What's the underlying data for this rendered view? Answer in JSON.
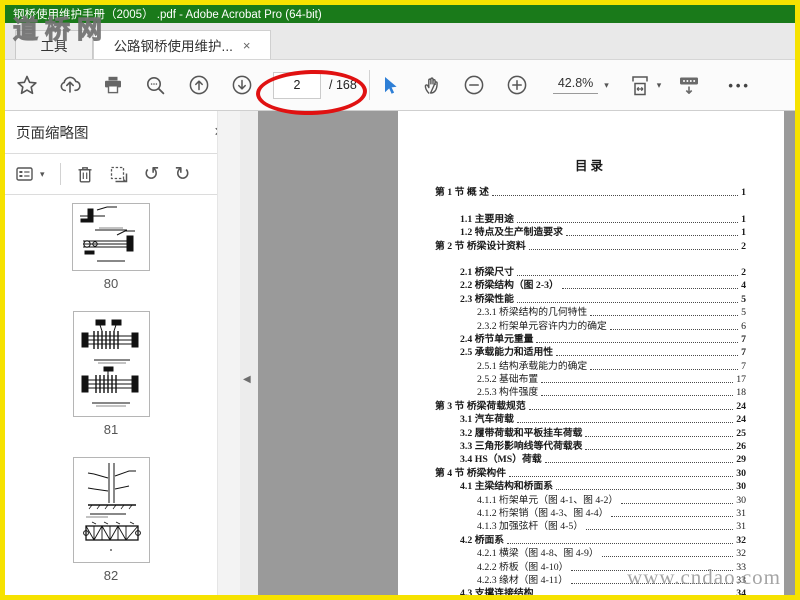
{
  "window": {
    "title": "钢桥使用维护手册（2005） .pdf - Adobe Acrobat Pro (64-bit)",
    "titlebar_color": "#1a7a1a",
    "frame_color": "#f6e200"
  },
  "watermarks": {
    "top_left": "道桥网",
    "bottom_right": "www.cndao.com"
  },
  "tabs": {
    "tools_label": "工具",
    "document_label": "公路钢桥使用维护..."
  },
  "toolbar": {
    "page_current": "2",
    "page_total": "/ 168",
    "zoom_level": "42.8%",
    "annotation_color": "#e01111",
    "pointer_color": "#2e7fd6"
  },
  "sidebar": {
    "title": "页面缩略图",
    "thumbnails": [
      {
        "page": "80"
      },
      {
        "page": "81"
      },
      {
        "page": "82"
      }
    ]
  },
  "document": {
    "toc_title": "目录",
    "entries": [
      {
        "level": 0,
        "label": "第 1 节 概 述",
        "page": "1",
        "gap_after": true
      },
      {
        "level": 1,
        "label": "1.1 主要用途",
        "page": "1"
      },
      {
        "level": 1,
        "label": "1.2 特点及生产制造要求",
        "page": "1"
      },
      {
        "level": 0,
        "label": "第 2 节 桥梁设计资料",
        "page": "2",
        "gap_after": true
      },
      {
        "level": 1,
        "label": "2.1 桥梁尺寸",
        "page": "2"
      },
      {
        "level": 1,
        "label": "2.2 桥梁结构（图 2-3）",
        "page": "4"
      },
      {
        "level": 1,
        "label": "2.3 桥梁性能",
        "page": "5"
      },
      {
        "level": 2,
        "label": "2.3.1 桥梁结构的几何特性",
        "page": "5"
      },
      {
        "level": 2,
        "label": "2.3.2 桁架单元容许内力的确定",
        "page": "6"
      },
      {
        "level": 1,
        "label": "2.4 桥节单元重量",
        "page": "7"
      },
      {
        "level": 1,
        "label": "2.5 承载能力和适用性",
        "page": "7"
      },
      {
        "level": 2,
        "label": "2.5.1 结构承载能力的确定",
        "page": "7"
      },
      {
        "level": 2,
        "label": "2.5.2 基础布置",
        "page": "17"
      },
      {
        "level": 2,
        "label": "2.5.3 构件强度",
        "page": "18"
      },
      {
        "level": 0,
        "label": "第 3 节 桥梁荷载规范",
        "page": "24"
      },
      {
        "level": 1,
        "label": "3.1 汽车荷载",
        "page": "24"
      },
      {
        "level": 1,
        "label": "3.2 履带荷载和平板挂车荷载",
        "page": "25"
      },
      {
        "level": 1,
        "label": "3.3 三角形影响线等代荷载表",
        "page": "26"
      },
      {
        "level": 1,
        "label": "3.4 HS（MS）荷载",
        "page": "29"
      },
      {
        "level": 0,
        "label": "第 4 节 桥梁构件",
        "page": "30"
      },
      {
        "level": 1,
        "label": "4.1 主梁结构和桥面系",
        "page": "30"
      },
      {
        "level": 2,
        "label": "4.1.1 桁架单元（图 4-1、图 4-2）",
        "page": "30"
      },
      {
        "level": 2,
        "label": "4.1.2 桁架销（图 4-3、图 4-4）",
        "page": "31"
      },
      {
        "level": 2,
        "label": "4.1.3 加强弦杆（图 4-5）",
        "page": "31"
      },
      {
        "level": 1,
        "label": "4.2 桥面系",
        "page": "32"
      },
      {
        "level": 2,
        "label": "4.2.1 横梁（图 4-8、图 4-9）",
        "page": "32"
      },
      {
        "level": 2,
        "label": "4.2.2 桥板（图 4-10）",
        "page": "33"
      },
      {
        "level": 2,
        "label": "4.2.3 缘材（图 4-11）",
        "page": "33"
      },
      {
        "level": 1,
        "label": "4.3 支撑连接结构",
        "page": "34"
      }
    ]
  },
  "icons": {
    "close": "×",
    "caret_down": "▾",
    "rotate_ccw": "↺",
    "rotate_cw": "↻",
    "collapse_left": "◀",
    "more": "•••"
  }
}
